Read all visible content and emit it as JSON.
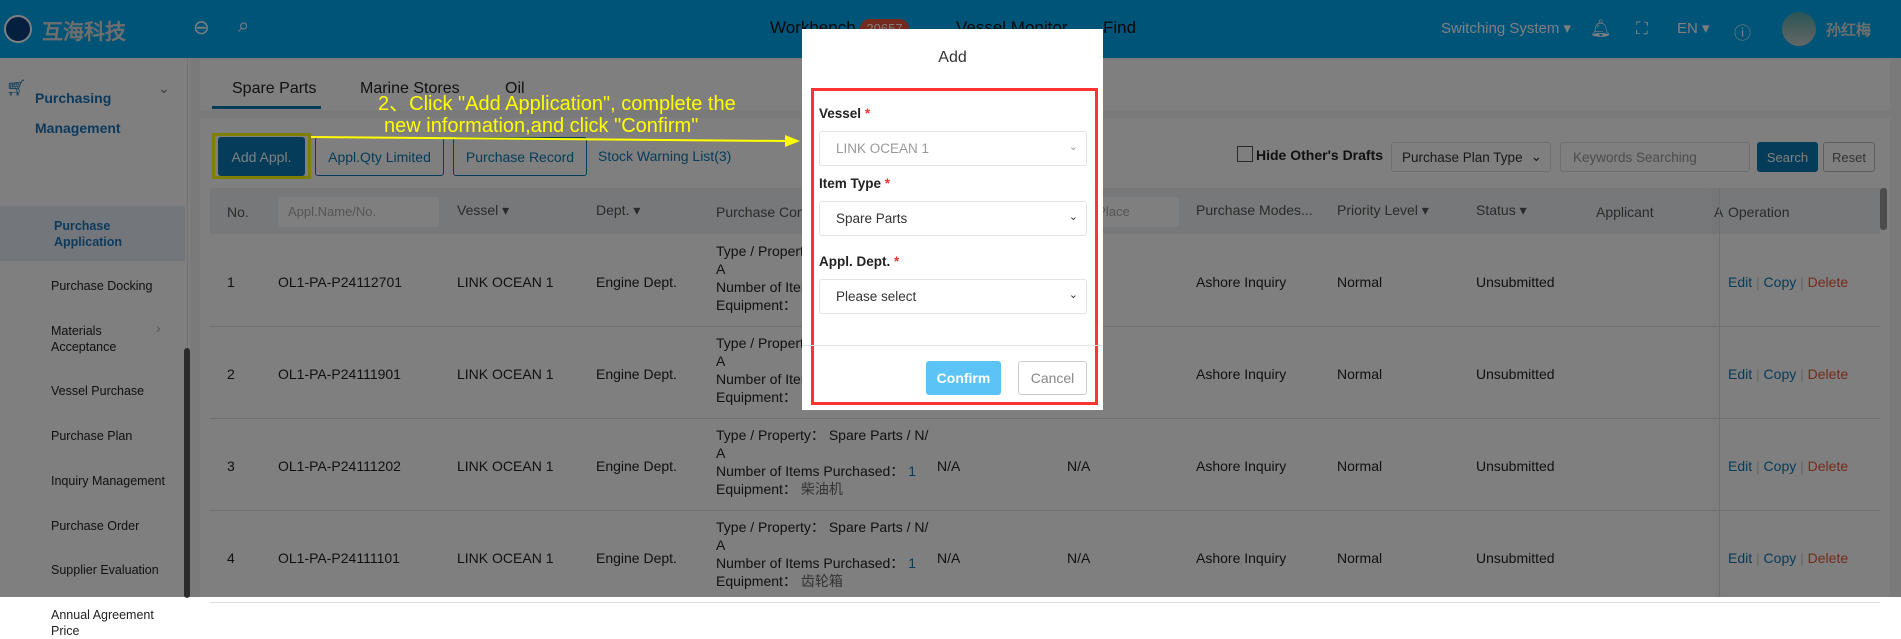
{
  "header": {
    "logo_text": "互海科技",
    "nav": [
      {
        "label": "Workbench",
        "badge": "20657"
      },
      {
        "label": "Vessel Monitor"
      },
      {
        "label": "Find"
      }
    ],
    "switching_system": "Switching System",
    "language": "EN",
    "user_name": "孙红梅",
    "colors": {
      "header": "#00a9f0",
      "badge": "#e8573a"
    }
  },
  "sidebar": {
    "group": {
      "label_line1": "Purchasing",
      "label_line2": "Management"
    },
    "items": [
      {
        "label": "Purchase Application",
        "selected": true
      },
      {
        "label": "Purchase Docking"
      },
      {
        "label": "Materials Acceptance"
      },
      {
        "label": "Vessel Purchase"
      },
      {
        "label": "Purchase Plan"
      },
      {
        "label": "Inquiry Management"
      },
      {
        "label": "Purchase Order"
      },
      {
        "label": "Supplier Evaluation"
      },
      {
        "label": "Annual Agreement Price"
      }
    ]
  },
  "tabs": [
    {
      "label": "Spare Parts",
      "active": true
    },
    {
      "label": "Marine Stores"
    },
    {
      "label": "Oil"
    }
  ],
  "toolbar": {
    "add": "Add Appl.",
    "qty_limited": "Appl.Qty Limited",
    "record": "Purchase Record",
    "stock_warning": "Stock Warning List(3)",
    "hide_drafts": "Hide Other's Drafts",
    "plan_type": "Purchase Plan Type",
    "keywords_placeholder": "Keywords Searching",
    "search": "Search",
    "reset": "Reset"
  },
  "table": {
    "headers": {
      "no": "No.",
      "appl_placeholder": "Appl.Name/No.",
      "vessel": "Vessel",
      "dept": "Dept.",
      "content": "Purchase Con",
      "place_placeholder": "ply Place",
      "modes": "Purchase Modes...",
      "priority": "Priority Level",
      "status": "Status",
      "applicant": "Applicant",
      "extra": "A",
      "operation": "Operation"
    },
    "labels": {
      "type": "Type / Property：",
      "count": "Number of Items Purchased：",
      "equip": "Equipment："
    },
    "actions": {
      "edit": "Edit",
      "copy": "Copy",
      "delete": "Delete"
    },
    "rows": [
      {
        "no": "1",
        "appl": "OL1-PA-P24112701",
        "vessel": "LINK OCEAN 1",
        "dept": "Engine Dept.",
        "type_line1": "",
        "type_line2": "A",
        "count": "",
        "equip": "",
        "col_a": "",
        "col_b": "",
        "mode": "Ashore Inquiry",
        "priority": "Normal",
        "status": "Unsubmitted"
      },
      {
        "no": "2",
        "appl": "OL1-PA-P24111901",
        "vessel": "LINK OCEAN 1",
        "dept": "Engine Dept.",
        "type_line1": "",
        "type_line2": "A",
        "count": "",
        "equip": "",
        "col_a": "",
        "col_b": "",
        "mode": "Ashore Inquiry",
        "priority": "Normal",
        "status": "Unsubmitted"
      },
      {
        "no": "3",
        "appl": "OL1-PA-P24111202",
        "vessel": "LINK OCEAN 1",
        "dept": "Engine Dept.",
        "type_line1": "Spare Parts / N/",
        "type_line2": "A",
        "count": "1",
        "equip": "柴油机",
        "col_a": "N/A",
        "col_b": "N/A",
        "mode": "Ashore Inquiry",
        "priority": "Normal",
        "status": "Unsubmitted"
      },
      {
        "no": "4",
        "appl": "OL1-PA-P24111101",
        "vessel": "LINK OCEAN 1",
        "dept": "Engine Dept.",
        "type_line1": "Spare Parts / N/",
        "type_line2": "A",
        "count": "1",
        "equip": "齿轮箱",
        "col_a": "N/A",
        "col_b": "N/A",
        "mode": "Ashore Inquiry",
        "priority": "Normal",
        "status": "Unsubmitted"
      }
    ]
  },
  "annotation": {
    "line1": "2、Click \"Add Application\", complete the",
    "line2": "new information,and click \"Confirm\"",
    "color": "#ffff00"
  },
  "modal": {
    "title": "Add",
    "vessel_label": "Vessel",
    "vessel_value": "LINK OCEAN 1",
    "item_type_label": "Item Type",
    "item_type_value": "Spare Parts",
    "dept_label": "Appl. Dept.",
    "dept_value": "Please select",
    "required_mark": "*",
    "confirm": "Confirm",
    "cancel": "Cancel",
    "colors": {
      "confirm": "#5bc3f5",
      "highlight": "#ff3333"
    }
  }
}
